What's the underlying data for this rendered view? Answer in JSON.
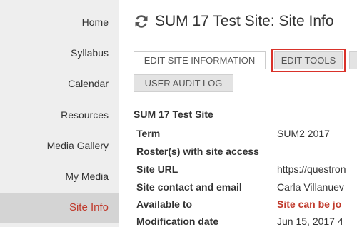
{
  "sidebar": {
    "items": [
      {
        "label": "Home"
      },
      {
        "label": "Syllabus"
      },
      {
        "label": "Calendar"
      },
      {
        "label": "Resources"
      },
      {
        "label": "Media Gallery"
      },
      {
        "label": "My Media"
      },
      {
        "label": "Site Info",
        "active": true
      }
    ]
  },
  "header": {
    "icon": "refresh-icon",
    "title": "SUM 17 Test Site: Site Info"
  },
  "toolbar": {
    "edit_site_information": "EDIT SITE INFORMATION",
    "edit_tools": "EDIT TOOLS",
    "user_audit_log": "USER AUDIT LOG"
  },
  "site": {
    "section_title": "SUM 17 Test Site",
    "rows": [
      {
        "label": "Term",
        "value": "SUM2 2017"
      },
      {
        "label": "Roster(s) with site access",
        "value": ""
      },
      {
        "label": "Site URL",
        "value": "https://questron"
      },
      {
        "label": "Site contact and email",
        "value": "Carla Villanuev"
      },
      {
        "label": "Available to",
        "value": "Site can be jo"
      },
      {
        "label": "Modification date",
        "value": "Jun 15, 2017 4"
      }
    ]
  },
  "colors": {
    "accent": "#c0392b",
    "highlight_border": "#d9322a",
    "sidebar_bg": "#eeeeee",
    "sidebar_active_bg": "#d4d4d4"
  }
}
